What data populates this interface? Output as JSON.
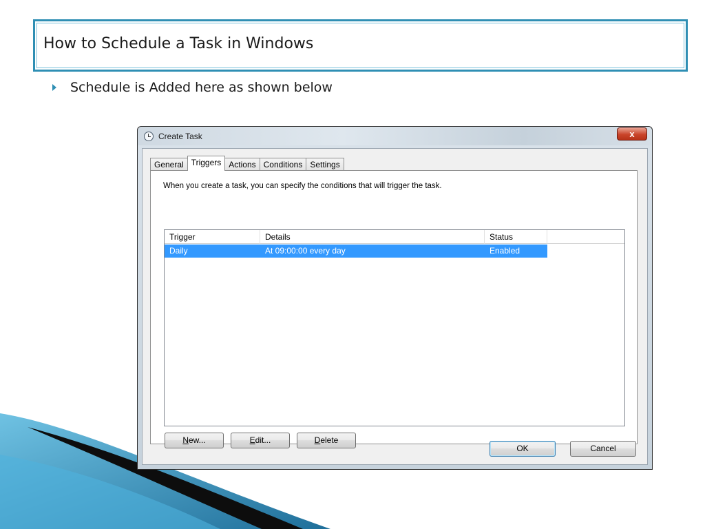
{
  "slide": {
    "title": "How to Schedule a Task in Windows",
    "bullet": "Schedule is Added here as shown below"
  },
  "dialog": {
    "title": "Create Task",
    "close_label": "x",
    "tabs": [
      "General",
      "Triggers",
      "Actions",
      "Conditions",
      "Settings"
    ],
    "active_tab": "Triggers",
    "description": "When you create a task, you can specify the conditions that will trigger the task.",
    "columns": [
      "Trigger",
      "Details",
      "Status"
    ],
    "rows": [
      {
        "trigger": "Daily",
        "details": "At 09:00:00 every day",
        "status": "Enabled",
        "selected": true
      }
    ],
    "buttons": {
      "new_accel": "N",
      "new_rest": "ew...",
      "edit_accel": "E",
      "edit_rest": "dit...",
      "delete_accel": "D",
      "delete_rest": "elete",
      "ok": "OK",
      "cancel": "Cancel"
    }
  },
  "colors": {
    "accent": "#2f8fb4",
    "selection": "#3399ff",
    "close_button": "#c9442a"
  },
  "icons": {
    "bullet": "bullet-arrow-icon",
    "window": "clock-icon",
    "close": "close-icon"
  }
}
